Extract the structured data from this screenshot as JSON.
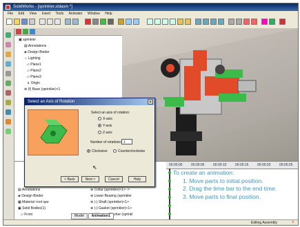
{
  "window": {
    "title": "SolidWorks - [sprinkler.sldasm *]"
  },
  "menubar": [
    "File",
    "Edit",
    "View",
    "Insert",
    "Tools",
    "Animator",
    "Window",
    "Help"
  ],
  "tree": {
    "items": [
      {
        "label": "sprinkler"
      },
      {
        "label": "Annotations"
      },
      {
        "label": "Design Binder"
      },
      {
        "label": "Lighting"
      },
      {
        "label": "Plane1"
      },
      {
        "label": "Plane2"
      },
      {
        "label": "Plane3"
      },
      {
        "label": "Origin"
      },
      {
        "label": "(f) Base (sprinkler)<1"
      }
    ]
  },
  "dialog": {
    "title": "Select an Axis of Rotation",
    "close": "×",
    "instruction": "Select an axis of rotation:",
    "axes": [
      "X-axis",
      "Y-axis",
      "Z-axis"
    ],
    "selected_axis": "Y-axis",
    "rotations_label": "Number of rotations:",
    "rotations_value": "1",
    "directions": [
      "Clockwise",
      "Counterclockwise"
    ],
    "selected_direction": "Clockwise",
    "buttons": {
      "back": "< Back",
      "next": "Next >",
      "cancel": "Cancel",
      "help": "Help"
    }
  },
  "animation": {
    "ruler": [
      "00:00:00",
      "00:00:05",
      "00:00:10",
      "00:00:15",
      "00:00:20",
      "00:00:25"
    ],
    "instructions": {
      "title": "To create an animation:",
      "steps": [
        "1. Move parts to initial position.",
        "2. Drag the time bar to the end time.",
        "3. Move parts to final position."
      ]
    },
    "tree_left": [
      {
        "label": "Annotations"
      },
      {
        "label": "Design Binder"
      },
      {
        "label": "Material <not spe"
      },
      {
        "label": "Solid Bodies(1)"
      },
      {
        "label": "Front"
      }
    ],
    "tree_right": [
      {
        "label": "Collar (sprinkler)<1> ->"
      },
      {
        "label": "Lower Bearing (sprinkler"
      },
      {
        "label": "(-) Shaft (sprinkler)<1>"
      },
      {
        "label": "(-) Gasket (sprinkler)<1>"
      },
      {
        "label": "(-) Lower Washer (sprinkl"
      }
    ],
    "tabs": [
      "Model",
      "Animation1"
    ]
  },
  "status": {
    "text": "Editing Assembly"
  },
  "colors": {
    "instruction_text": "#3e97c2",
    "title_bar": "#0a246a",
    "preview_bg": "#f7a15d",
    "part_green": "#3dbb4a"
  }
}
